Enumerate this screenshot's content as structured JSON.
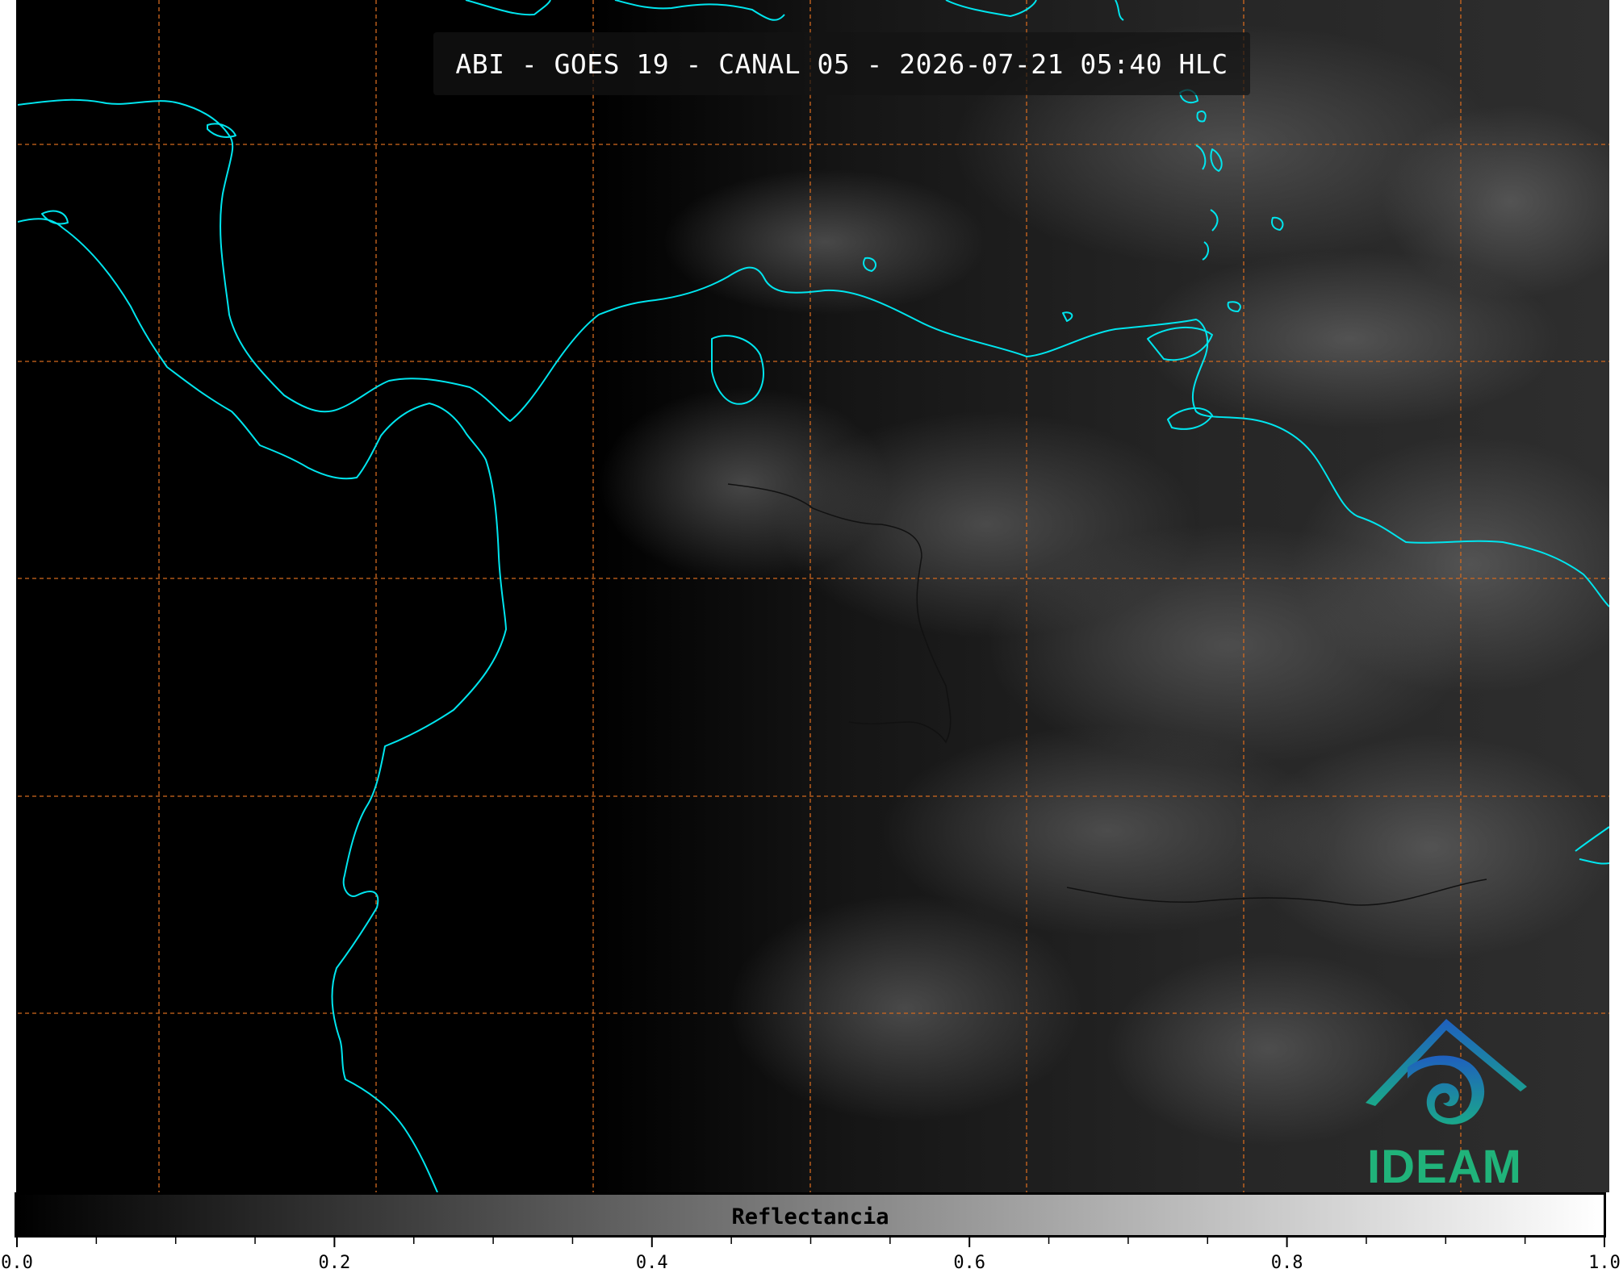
{
  "title": "ABI - GOES 19 - CANAL 05 - 2026-07-21 05:40 HLC",
  "logo": {
    "text": "IDEAM",
    "icon": "ideam-logo-icon",
    "colors": [
      "#1f5fbf",
      "#1aa88a",
      "#20b37a"
    ]
  },
  "colorbar": {
    "label": "Reflectancia",
    "min": 0.0,
    "max": 1.0,
    "colormap": [
      "#000000",
      "#ffffff"
    ],
    "tick_labels": [
      "0.0",
      "0.2",
      "0.4",
      "0.6",
      "0.8",
      "1.0"
    ]
  },
  "map": {
    "coastline_color": "#00e5ee",
    "graticule_color": "#d2691e",
    "graticule_style": "dashed",
    "border_color": "#111111"
  }
}
